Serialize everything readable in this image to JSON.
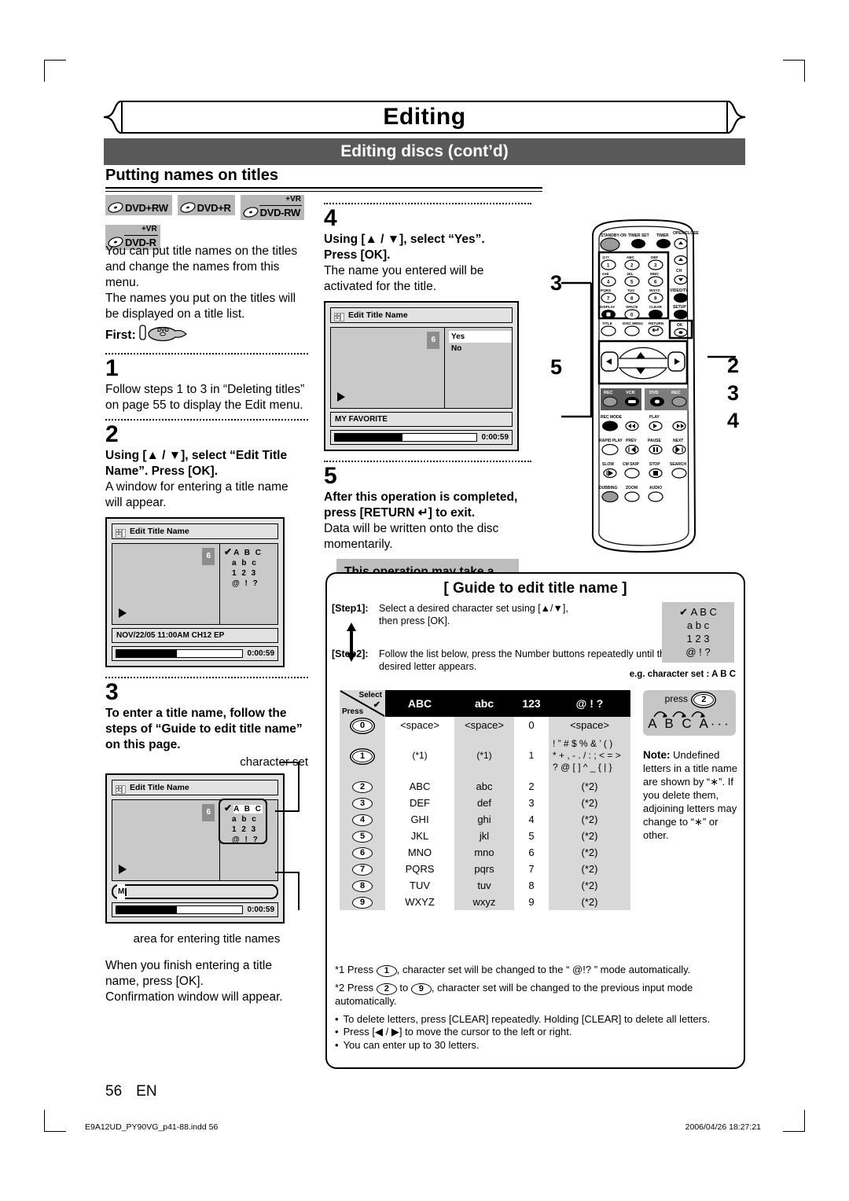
{
  "header": {
    "chapter": "Editing",
    "section": "Editing discs (cont’d)",
    "subsection": "Putting names on titles"
  },
  "disc_badges": [
    {
      "label": "DVD+RW",
      "vr": ""
    },
    {
      "label": "DVD+R",
      "vr": ""
    },
    {
      "label": "DVD-RW",
      "vr": "+VR"
    },
    {
      "label": "DVD-R",
      "vr": "+VR"
    }
  ],
  "intro": {
    "p1": "You can put title names on the titles and change the names from this menu.",
    "p2": "The names you put on the titles will be displayed on a title list.",
    "first_label": "First:"
  },
  "steps": {
    "s1": {
      "num": "1",
      "body": "Follow steps 1 to 3 in “Deleting titles” on page 55 to display the Edit menu."
    },
    "s2": {
      "num": "2",
      "bold": "Using [▲ / ▼], select “Edit Title Name”. Press [OK].",
      "body": "A window for entering a title name will appear."
    },
    "s3": {
      "num": "3",
      "bold": "To enter a title name, follow the steps of “Guide to edit title name” on this page.",
      "caption_charset": "character set",
      "caption_area": "area for entering title names",
      "body": "When you finish entering a title name, press [OK].",
      "body2": "Confirmation window will appear."
    },
    "s4": {
      "num": "4",
      "bold1": "Using [▲ / ▼], select “Yes”.",
      "bold2": "Press [OK].",
      "body": "The name you entered will be activated for the title."
    },
    "s5": {
      "num": "5",
      "bold1": "After this operation is completed,",
      "bold2": "press [RETURN ↵] to exit.",
      "body": "Data will be written onto the disc momentarily.",
      "highlight": "This operation may take a while to be completed."
    }
  },
  "osd": {
    "title": "Edit Title Name",
    "chip": "6",
    "charset_rows": [
      "A B C",
      "a b c",
      "1 2 3",
      "@ ! ?"
    ],
    "meta_step2": "NOV/22/05 11:00AM CH12 EP",
    "meta_step3": "M",
    "meta_step4": "MY FAVORITE",
    "time": "0:00:59",
    "options": [
      "Yes",
      "No"
    ]
  },
  "guide": {
    "title": "[ Guide to edit title name ]",
    "step1_key": "[Step1]:",
    "step1_text_a": "Select a desired character set using [▲/▼],",
    "step1_text_b": "then press [OK].",
    "step2_key": "[Step2]:",
    "step2_text_a": "Follow the list below, press the Number buttons repeatedly until the",
    "step2_text_b": "desired letter appears.",
    "charset_chip": [
      "A B C",
      "a b c",
      "1 2 3",
      "@ ! ?"
    ],
    "eg": "e.g. character set :  A B C",
    "table": {
      "corner_select": "Select",
      "corner_press": "Press",
      "columns": [
        "ABC",
        "abc",
        "123",
        "@ ! ?"
      ],
      "rows": [
        {
          "key": "0",
          "cells": [
            "<space>",
            "<space>",
            "0",
            "<space>"
          ]
        },
        {
          "key": "1",
          "cells": [
            "(*1)",
            "(*1)",
            "1",
            "! ” # $ % & ’ ( )\n* + , - . / : ; < = >\n? @ [ ] ^ _ { | }"
          ]
        },
        {
          "key": "2",
          "cells": [
            "ABC",
            "abc",
            "2",
            "(*2)"
          ]
        },
        {
          "key": "3",
          "cells": [
            "DEF",
            "def",
            "3",
            "(*2)"
          ]
        },
        {
          "key": "4",
          "cells": [
            "GHI",
            "ghi",
            "4",
            "(*2)"
          ]
        },
        {
          "key": "5",
          "cells": [
            "JKL",
            "jkl",
            "5",
            "(*2)"
          ]
        },
        {
          "key": "6",
          "cells": [
            "MNO",
            "mno",
            "6",
            "(*2)"
          ]
        },
        {
          "key": "7",
          "cells": [
            "PQRS",
            "pqrs",
            "7",
            "(*2)"
          ]
        },
        {
          "key": "8",
          "cells": [
            "TUV",
            "tuv",
            "8",
            "(*2)"
          ]
        },
        {
          "key": "9",
          "cells": [
            "WXYZ",
            "wxyz",
            "9",
            "(*2)"
          ]
        }
      ]
    },
    "example": {
      "press": "press",
      "key": "2",
      "letters": "A B C A···"
    },
    "note": {
      "title": "Note:",
      "body": "Undefined letters in a title name are shown by “∗”.  If you delete them, adjoining letters may change to “∗” or other."
    },
    "footnotes": {
      "f1_a": "*1 Press",
      "f1_key": "1",
      "f1_b": ", character set will be changed to the “  @!?  ” mode automatically.",
      "f2_a": "*2 Press",
      "f2_key_a": "2",
      "f2_mid": "to",
      "f2_key_b": "9",
      "f2_b": ", character set will be changed to the previous input mode automatically.",
      "b1": "To delete letters, press [CLEAR] repeatedly. Holding [CLEAR] to delete all letters.",
      "b2": "Press [◀ / ▶] to move the cursor to the left or right.",
      "b3": "You can enter up to 30 letters."
    }
  },
  "remote": {
    "labels": {
      "standby": "STANDBY-ON",
      "timer_set": "TIMER SET",
      "timer": "TIMER",
      "open_close": "OPEN/CLOSE",
      "ch": "CH",
      "video_tv": "VIDEO/TV",
      "setup": "SETUP",
      "display": "DISPLAY",
      "space": "SPACE",
      "clear": "CLEAR",
      "title": "TITLE",
      "disc_menu": "DISC MENU",
      "return": "RETURN",
      "ok": "OK",
      "rec": "REC",
      "vcr": "VCR",
      "dvd": "DVD",
      "rec_mode": "REC MODE",
      "play": "PLAY",
      "rapid_play": "RAPID PLAY",
      "prev": "PREV",
      "pause": "PAUSE",
      "next": "NEXT",
      "slow": "SLOW",
      "cm_skip": "CM SKIP",
      "stop": "STOP",
      "search": "SEARCH",
      "dubbing": "DUBBING",
      "zoom": "ZOOM",
      "audio": "AUDIO"
    },
    "keypad": [
      {
        "num": "1",
        "letters": "@!?"
      },
      {
        "num": "2",
        "letters": "ABC"
      },
      {
        "num": "3",
        "letters": "DEF"
      },
      {
        "num": "4",
        "letters": "GHI"
      },
      {
        "num": "5",
        "letters": "JKL"
      },
      {
        "num": "6",
        "letters": "MNO"
      },
      {
        "num": "7",
        "letters": "PQRS"
      },
      {
        "num": "8",
        "letters": "TUV"
      },
      {
        "num": "9",
        "letters": "WXYZ"
      },
      {
        "num": "0",
        "letters": "SPACE"
      }
    ],
    "callouts": {
      "c3": "3",
      "c5": "5",
      "c2": "2",
      "c3b": "3",
      "c4": "4"
    }
  },
  "footer": {
    "page": "56",
    "lang": "EN",
    "file": "E9A12UD_PY90VG_p41-88.indd   56",
    "date": "2006/04/26   18:27:21"
  }
}
